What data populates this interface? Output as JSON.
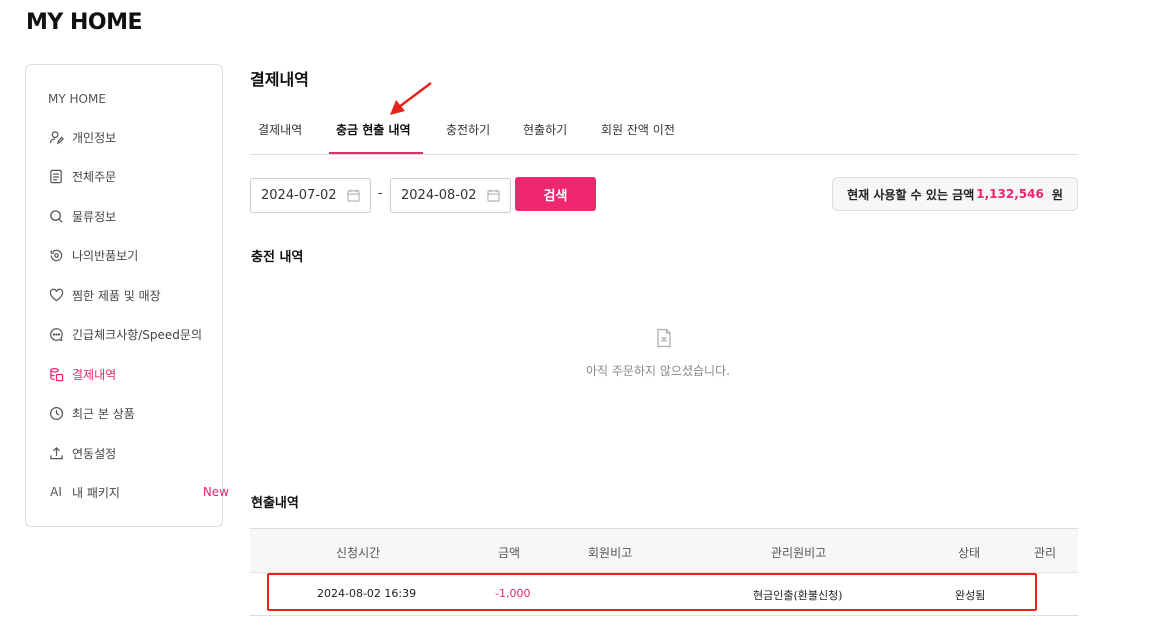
{
  "page": {
    "title": "MY HOME"
  },
  "sidebar": {
    "title": "MY HOME",
    "items": [
      {
        "label": "개인정보",
        "icon": "user-edit-icon"
      },
      {
        "label": "전체주문",
        "icon": "document-icon"
      },
      {
        "label": "물류정보",
        "icon": "search-icon"
      },
      {
        "label": "나의반품보기",
        "icon": "return-icon"
      },
      {
        "label": "찜한 제품 및 매장",
        "icon": "heart-icon"
      },
      {
        "label": "긴급체크사항/Speed문의",
        "icon": "chat-icon"
      },
      {
        "label": "결제내역",
        "icon": "payment-icon",
        "active": true
      },
      {
        "label": "최근 본 상품",
        "icon": "clock-icon"
      },
      {
        "label": "연동설정",
        "icon": "upload-icon"
      },
      {
        "label": "내 패키지",
        "icon": "ai-icon",
        "icon_text": "AI",
        "badge": "New"
      }
    ]
  },
  "main": {
    "title": "결제내역",
    "tabs": [
      {
        "label": "결제내역"
      },
      {
        "label": "충금 현출 내역",
        "active": true
      },
      {
        "label": "충전하기"
      },
      {
        "label": "현출하기"
      },
      {
        "label": "회원 잔액 이전"
      }
    ],
    "filters": {
      "start_date": "2024-07-02",
      "separator": "-",
      "end_date": "2024-08-02",
      "search_label": "검색"
    },
    "balance": {
      "label": "현재 사용할 수 있는 금액",
      "amount": "1,132,546",
      "unit": "원"
    },
    "charge_section": {
      "title": "충전 내역",
      "empty_text": "아직 주문하지 않으셨습니다."
    },
    "withdraw_section": {
      "title": "현출내역",
      "columns": [
        "신청시간",
        "금액",
        "회원비고",
        "관리원비고",
        "상태",
        "관리"
      ],
      "rows": [
        {
          "time": "2024-08-02 16:39",
          "amount": "-1,000",
          "member_note": "",
          "admin_note": "현금인출(환불신청)",
          "status": "완성됨",
          "manage": ""
        }
      ]
    }
  },
  "colors": {
    "accent": "#e8266f",
    "highlight": "#e3241c"
  }
}
